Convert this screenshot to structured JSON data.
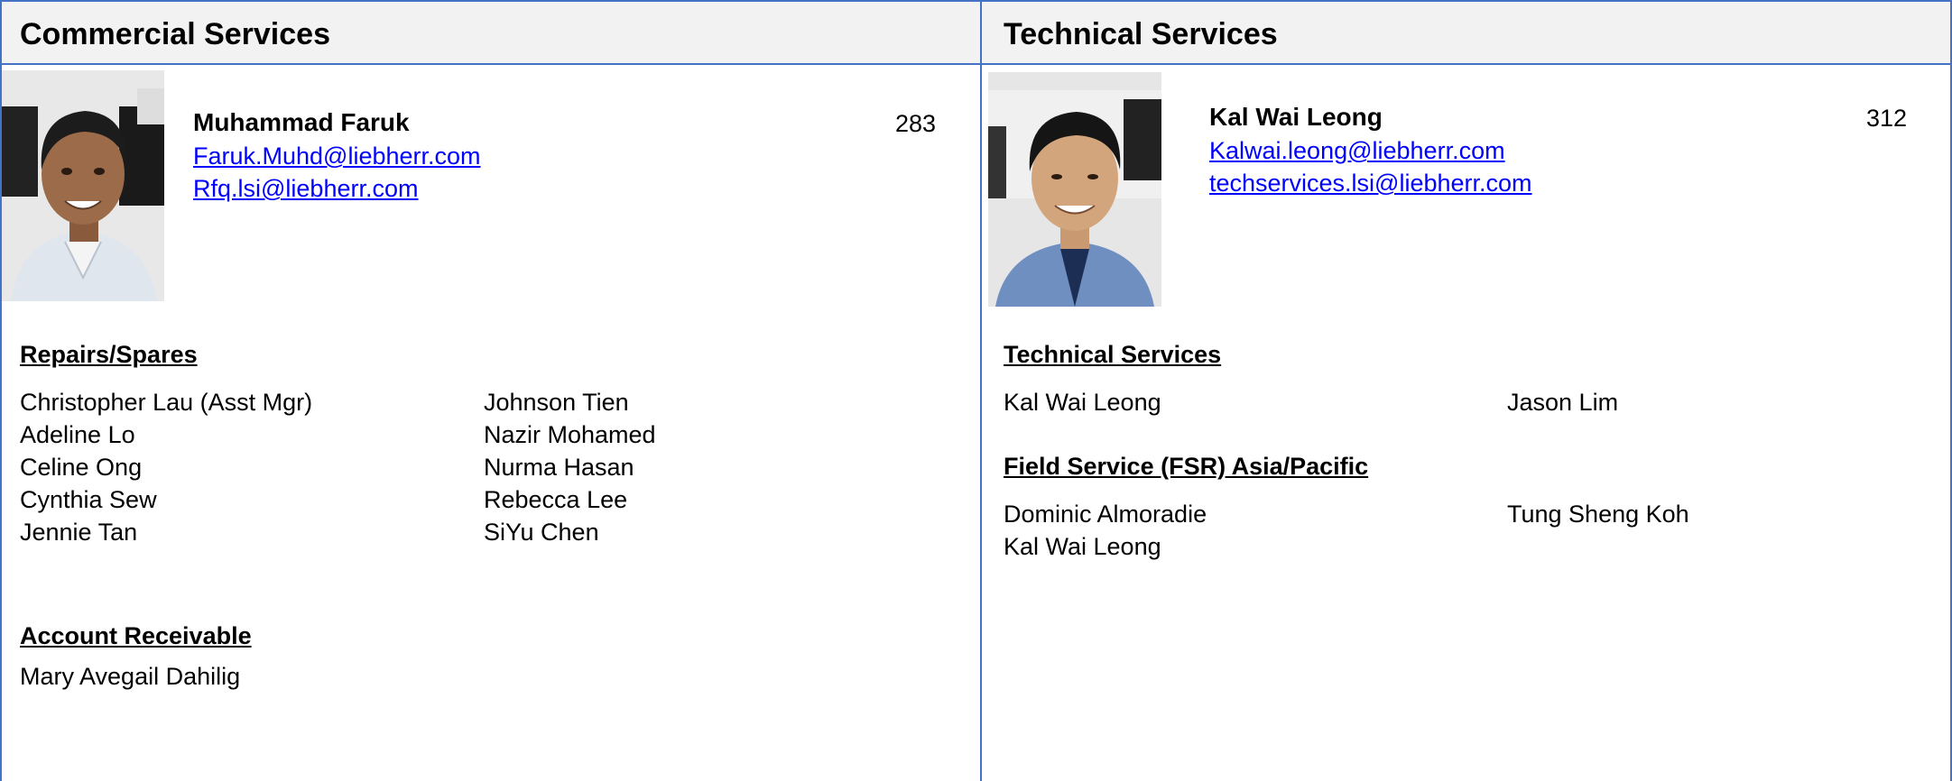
{
  "left": {
    "header": "Commercial Services",
    "manager": {
      "name": "Muhammad Faruk",
      "ext": "283",
      "email1": "Faruk.Muhd@liebherr.com",
      "email2": "Rfq.lsi@liebherr.com",
      "photo": "portrait-photo"
    },
    "sections": [
      {
        "title": "Repairs/Spares",
        "col1": [
          "Christopher Lau (Asst Mgr)",
          "Adeline Lo",
          "Celine Ong",
          "Cynthia Sew",
          "Jennie Tan"
        ],
        "col2": [
          "Johnson Tien",
          "Nazir Mohamed",
          "Nurma Hasan",
          "Rebecca Lee",
          "SiYu Chen"
        ]
      },
      {
        "title": "Account Receivable",
        "col1": [
          "Mary Avegail Dahilig"
        ]
      }
    ]
  },
  "right": {
    "header": "Technical Services",
    "manager": {
      "name": "Kal Wai Leong",
      "ext": "312",
      "email1": "Kalwai.leong@liebherr.com",
      "email2": "techservices.lsi@liebherr.com",
      "photo": "portrait-photo"
    },
    "sections": [
      {
        "title": "Technical Services",
        "col1": [
          "Kal Wai Leong"
        ],
        "col2": [
          "Jason Lim"
        ]
      },
      {
        "title": "Field Service (FSR) Asia/Pacific",
        "col1": [
          "Dominic Almoradie",
          "Kal Wai Leong"
        ],
        "col2": [
          "Tung Sheng Koh"
        ]
      }
    ]
  },
  "colors": {
    "border": "#4472c4",
    "header_bg": "#f2f2f2",
    "link": "#0000ff"
  }
}
